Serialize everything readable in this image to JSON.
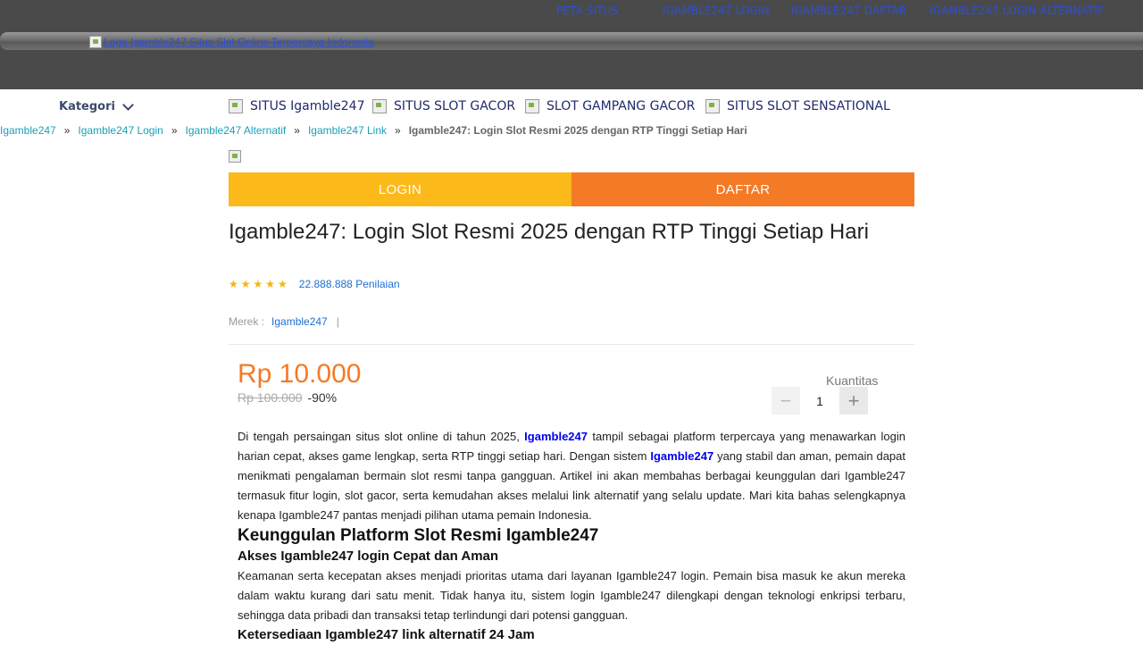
{
  "top_links": [
    "PETA SITUS",
    "IGAMBLE247 LOGIN",
    "IGAMBLE247 DAFTAR",
    "IGAMBLE247 LOGIN ALTERNATIF"
  ],
  "logo_alt": "Logo Igamble247 Situs Slot Online Terpercaya Indonesia",
  "kategori_label": "Kategori",
  "nav_items": [
    "SITUS Igamble247",
    "SITUS SLOT GACOR",
    "SLOT GAMPANG GACOR",
    "SITUS SLOT SENSATIONAL"
  ],
  "breadcrumb": {
    "links": [
      "Igamble247",
      "Igamble247 Login",
      "Igamble247 Alternatif",
      "Igamble247 Link"
    ],
    "separator": "»",
    "current": "Igamble247: Login Slot Resmi 2025 dengan RTP Tinggi Setiap Hari"
  },
  "buttons": {
    "login": "LOGIN",
    "daftar": "DAFTAR"
  },
  "product": {
    "title": "Igamble247: Login Slot Resmi 2025 dengan RTP Tinggi Setiap Hari",
    "stars": "★★★★★",
    "rating_value": 5,
    "reviews": "22.888.888 Penilaian",
    "brand_label": "Merek :",
    "brand_value": "Igamble247",
    "brand_sep": "|",
    "price": "Rp 10.000",
    "old_price": "Rp 100.000",
    "discount": "-90%",
    "qty_label": "Kuantitas",
    "qty_value": "1",
    "qty_minus": "−",
    "qty_plus": "+"
  },
  "article": {
    "p1_a": "Di tengah persaingan situs slot online di tahun 2025, ",
    "p1_link1": "Igamble247",
    "p1_b": " tampil sebagai platform terpercaya yang menawarkan login harian cepat, akses game lengkap, serta RTP tinggi setiap hari. Dengan sistem ",
    "p1_link2": "Igamble247",
    "p1_c": " yang stabil dan aman, pemain dapat menikmati pengalaman bermain slot resmi tanpa gangguan. Artikel ini akan membahas berbagai keunggulan dari Igamble247 termasuk fitur login, slot gacor, serta kemudahan akses melalui link alternatif yang selalu update. Mari kita bahas selengkapnya kenapa Igamble247 pantas menjadi pilihan utama pemain Indonesia.",
    "h2": "Keunggulan Platform Slot Resmi Igamble247",
    "h3a": "Akses Igamble247 login Cepat dan Aman",
    "p2": "Keamanan serta kecepatan akses menjadi prioritas utama dari layanan Igamble247 login. Pemain bisa masuk ke akun mereka dalam waktu kurang dari satu menit. Tidak hanya itu, sistem login Igamble247 dilengkapi dengan teknologi enkripsi terbaru, sehingga data pribadi dan transaksi tetap terlindungi dari potensi gangguan.",
    "h3b": "Ketersediaan Igamble247 link alternatif 24 Jam"
  },
  "colors": {
    "login_btn": "#fbb91a",
    "daftar_btn": "#f47a25",
    "price": "#f47a25",
    "topbar": "#4a4a4a",
    "star": "#f7b500"
  }
}
